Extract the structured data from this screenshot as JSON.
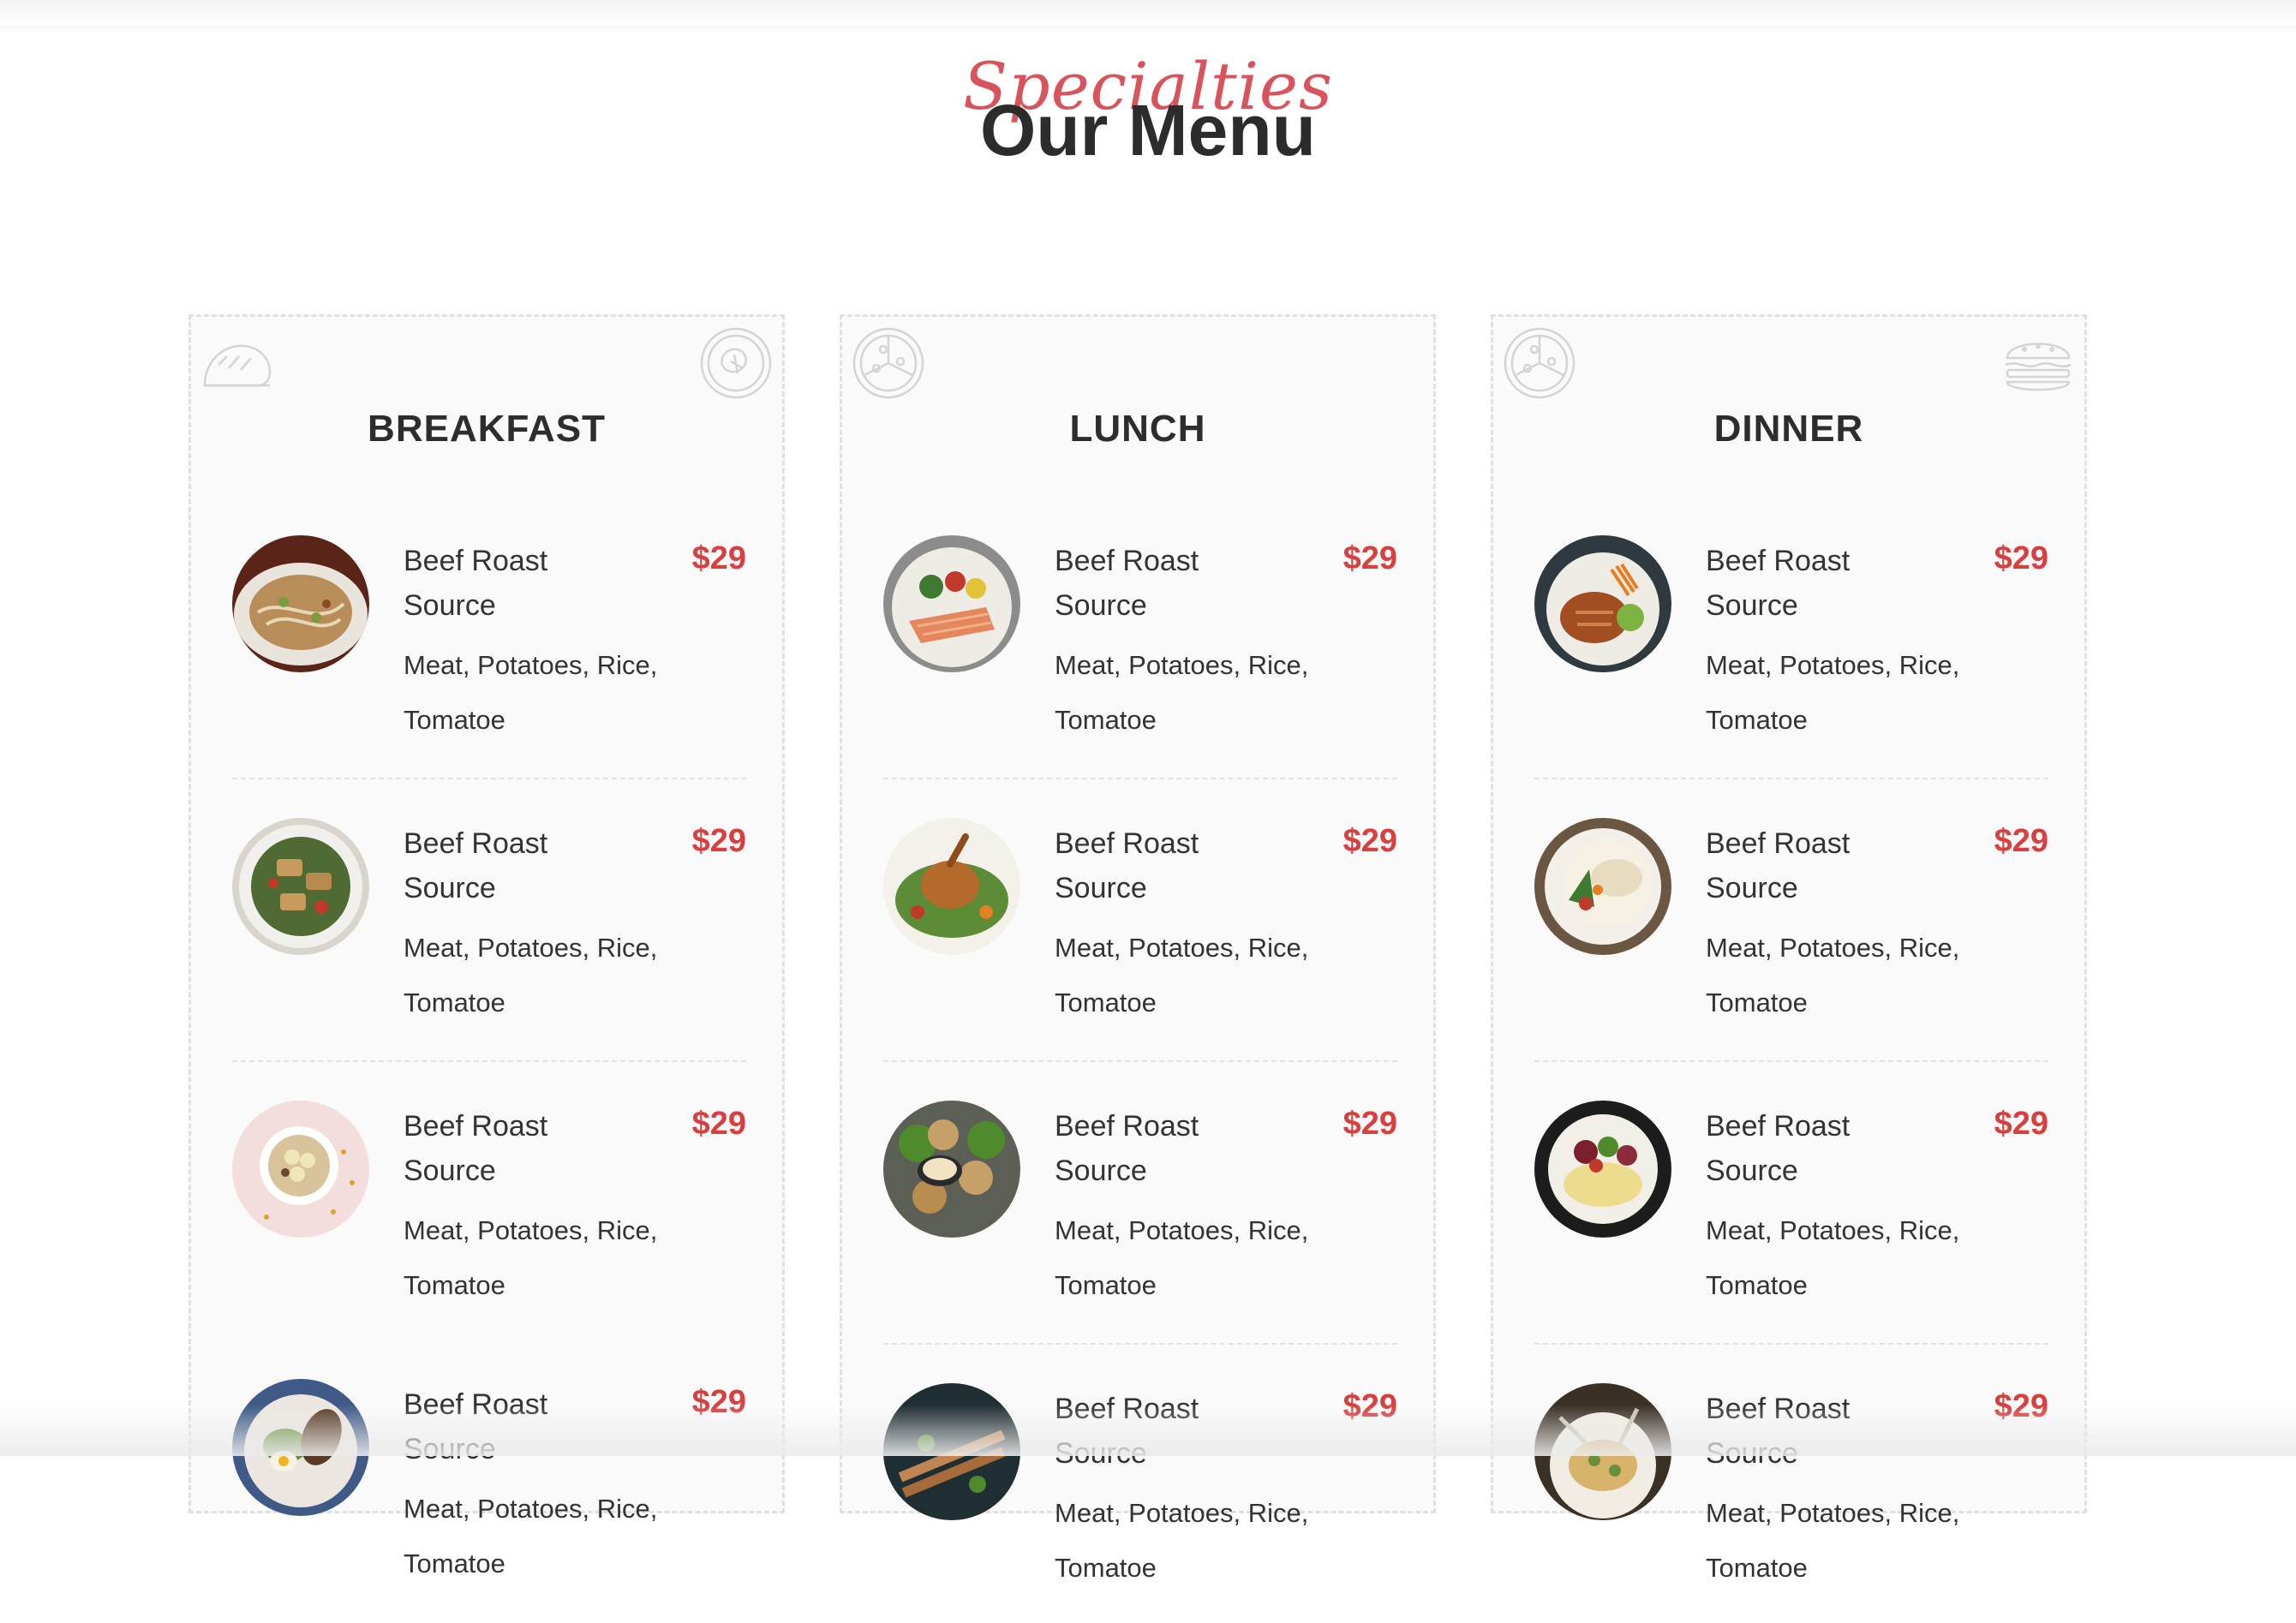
{
  "heading": {
    "script": "Specialties",
    "title": "Our Menu"
  },
  "colors": {
    "accent": "#d8535b",
    "price": "#d8403f",
    "text": "#333333"
  },
  "cards": [
    {
      "title": "BREAKFAST",
      "icons": [
        "bread-icon",
        "salad-bowl-icon"
      ],
      "items": [
        {
          "name": "Beef Roast Source",
          "price": "$29",
          "desc": "Meat, Potatoes, Rice, Tomatoe",
          "image": "noodle-dish"
        },
        {
          "name": "Beef Roast Source",
          "price": "$29",
          "desc": "Meat, Potatoes, Rice, Tomatoe",
          "image": "grilled-salad"
        },
        {
          "name": "Beef Roast Source",
          "price": "$29",
          "desc": "Meat, Potatoes, Rice, Tomatoe",
          "image": "oatmeal-bowl"
        },
        {
          "name": "Beef Roast Source",
          "price": "$29",
          "desc": "Meat, Potatoes, Rice, Tomatoe",
          "image": "breakfast-plate"
        }
      ]
    },
    {
      "title": "LUNCH",
      "icons": [
        "pizza-icon"
      ],
      "items": [
        {
          "name": "Beef Roast Source",
          "price": "$29",
          "desc": "Meat, Potatoes, Rice, Tomatoe",
          "image": "salmon-plate"
        },
        {
          "name": "Beef Roast Source",
          "price": "$29",
          "desc": "Meat, Potatoes, Rice, Tomatoe",
          "image": "roast-chicken"
        },
        {
          "name": "Beef Roast Source",
          "price": "$29",
          "desc": "Meat, Potatoes, Rice, Tomatoe",
          "image": "fried-chicken-dip"
        },
        {
          "name": "Beef Roast Source",
          "price": "$29",
          "desc": "Meat, Potatoes, Rice, Tomatoe",
          "image": "skewers"
        }
      ]
    },
    {
      "title": "DINNER",
      "icons": [
        "pizza-icon",
        "burger-icon"
      ],
      "items": [
        {
          "name": "Beef Roast Source",
          "price": "$29",
          "desc": "Meat, Potatoes, Rice, Tomatoe",
          "image": "glazed-chicken"
        },
        {
          "name": "Beef Roast Source",
          "price": "$29",
          "desc": "Meat, Potatoes, Rice, Tomatoe",
          "image": "white-soup"
        },
        {
          "name": "Beef Roast Source",
          "price": "$29",
          "desc": "Meat, Potatoes, Rice, Tomatoe",
          "image": "omelette-plate"
        },
        {
          "name": "Beef Roast Source",
          "price": "$29",
          "desc": "Meat, Potatoes, Rice, Tomatoe",
          "image": "pasta-dish"
        }
      ]
    }
  ]
}
